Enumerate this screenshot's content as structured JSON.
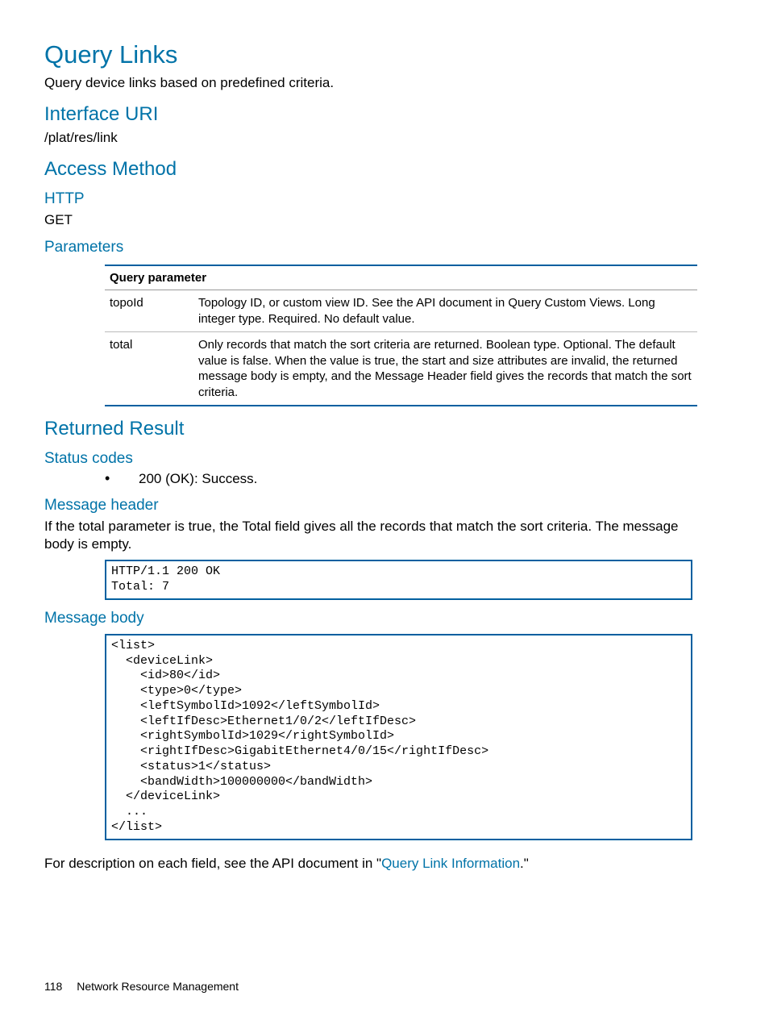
{
  "title": "Query Links",
  "intro": "Query device links based on predefined criteria.",
  "sections": {
    "interface_uri": {
      "heading": "Interface URI",
      "value": "/plat/res/link"
    },
    "access_method": {
      "heading": "Access Method",
      "http": {
        "heading": "HTTP",
        "value": "GET"
      },
      "parameters": {
        "heading": "Parameters",
        "table_header": "Query parameter",
        "rows": [
          {
            "name": "topoId",
            "desc": "Topology ID, or custom view ID. See the API document in Query Custom Views.\nLong integer type. Required. No default value."
          },
          {
            "name": "total",
            "desc": "Only records that match the sort criteria are returned.\nBoolean type. Optional. The default value is false. When the value is true, the start and size attributes are invalid, the returned message body is empty, and the Message Header field gives the records that match the sort criteria."
          }
        ]
      }
    },
    "returned_result": {
      "heading": "Returned Result",
      "status_codes": {
        "heading": "Status codes",
        "bullet": "200 (OK): Success."
      },
      "message_header": {
        "heading": "Message header",
        "para": "If the total parameter is true, the Total field gives all the records that match the sort criteria. The message body is empty.",
        "code": "HTTP/1.1 200 OK\nTotal: 7"
      },
      "message_body": {
        "heading": "Message body",
        "code": "<list>\n  <deviceLink>\n    <id>80</id>\n    <type>0</type>\n    <leftSymbolId>1092</leftSymbolId>\n    <leftIfDesc>Ethernet1/0/2</leftIfDesc>\n    <rightSymbolId>1029</rightSymbolId>\n    <rightIfDesc>GigabitEthernet4/0/15</rightIfDesc>\n    <status>1</status>\n    <bandWidth>100000000</bandWidth>\n  </deviceLink>\n  ...\n</list>",
        "after_text_pre": "For description on each field, see the API document in \"",
        "after_link": "Query Link Information",
        "after_text_post": ".\""
      }
    }
  },
  "footer": {
    "page_number": "118",
    "chapter": "Network Resource Management"
  }
}
